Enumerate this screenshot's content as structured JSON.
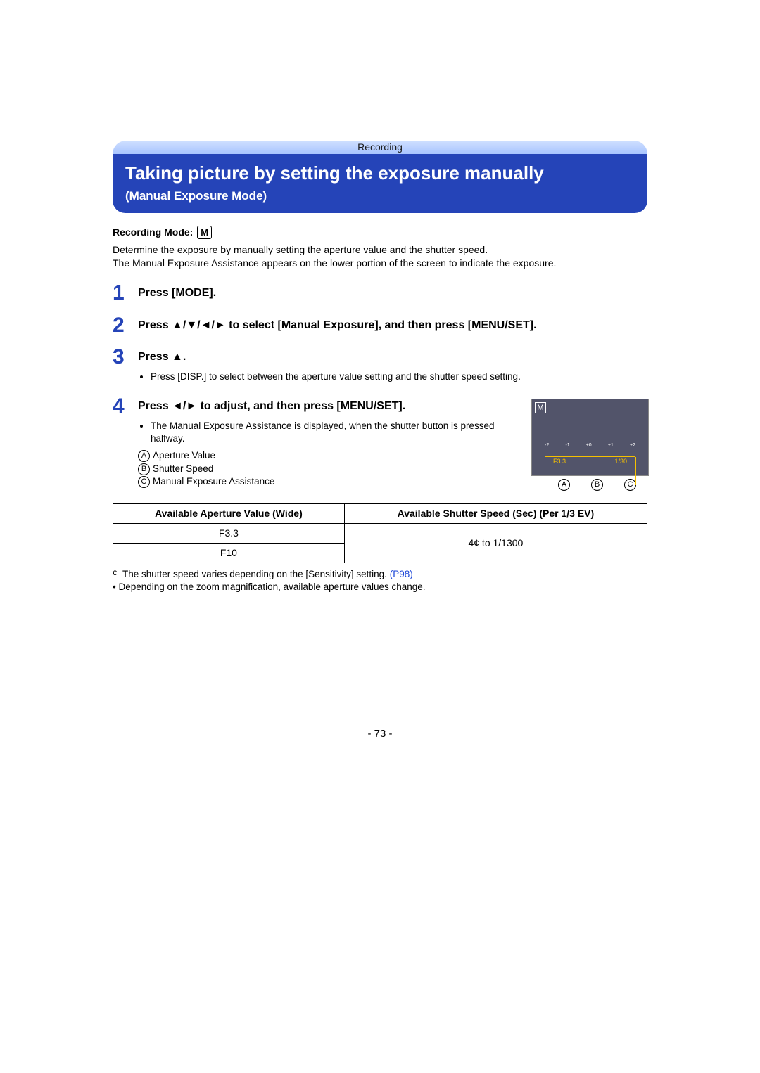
{
  "header": {
    "section": "Recording",
    "title": "Taking picture by setting the exposure manually",
    "subtitle": "(Manual Exposure Mode)"
  },
  "rec_mode": {
    "label": "Recording Mode:",
    "chip": "M"
  },
  "intro": "Determine the exposure by manually setting the aperture value and the shutter speed.\nThe Manual Exposure Assistance appears on the lower portion of the screen to indicate the exposure.",
  "steps": {
    "s1": {
      "num": "1",
      "head": "Press [MODE]."
    },
    "s2": {
      "num": "2",
      "head": "Press ▲/▼/◄/► to select [Manual Exposure], and then press [MENU/SET]."
    },
    "s3": {
      "num": "3",
      "head": "Press ▲.",
      "bullet": "Press [DISP.] to select between the aperture value setting and the shutter speed setting."
    },
    "s4": {
      "num": "4",
      "head": "Press ◄/► to adjust, and then press [MENU/SET].",
      "bullet": "The Manual Exposure Assistance is displayed, when the shutter button is pressed halfway.",
      "a": "Aperture Value",
      "b": "Shutter Speed",
      "c": "Manual Exposure Assistance"
    }
  },
  "lcd": {
    "mode": "M",
    "ticks": [
      "-2",
      "-1",
      "±0",
      "+1",
      "+2"
    ],
    "ap": "F3.3",
    "ss": "1/30",
    "labels": {
      "a": "A",
      "b": "B",
      "c": "C"
    }
  },
  "table": {
    "h1": "Available Aperture Value (Wide)",
    "h2": "Available Shutter Speed (Sec) (Per 1/3 EV)",
    "r1c1": "F3.3",
    "r2c1": "F10",
    "r_c2": "4¢ to 1/1300"
  },
  "footnotes": {
    "star": "¢",
    "f1": "The shutter speed varies depending on the [Sensitivity] setting.",
    "link": "(P98)",
    "f2": "Depending on the zoom magnification, available aperture values change."
  },
  "page_number": "- 73 -"
}
